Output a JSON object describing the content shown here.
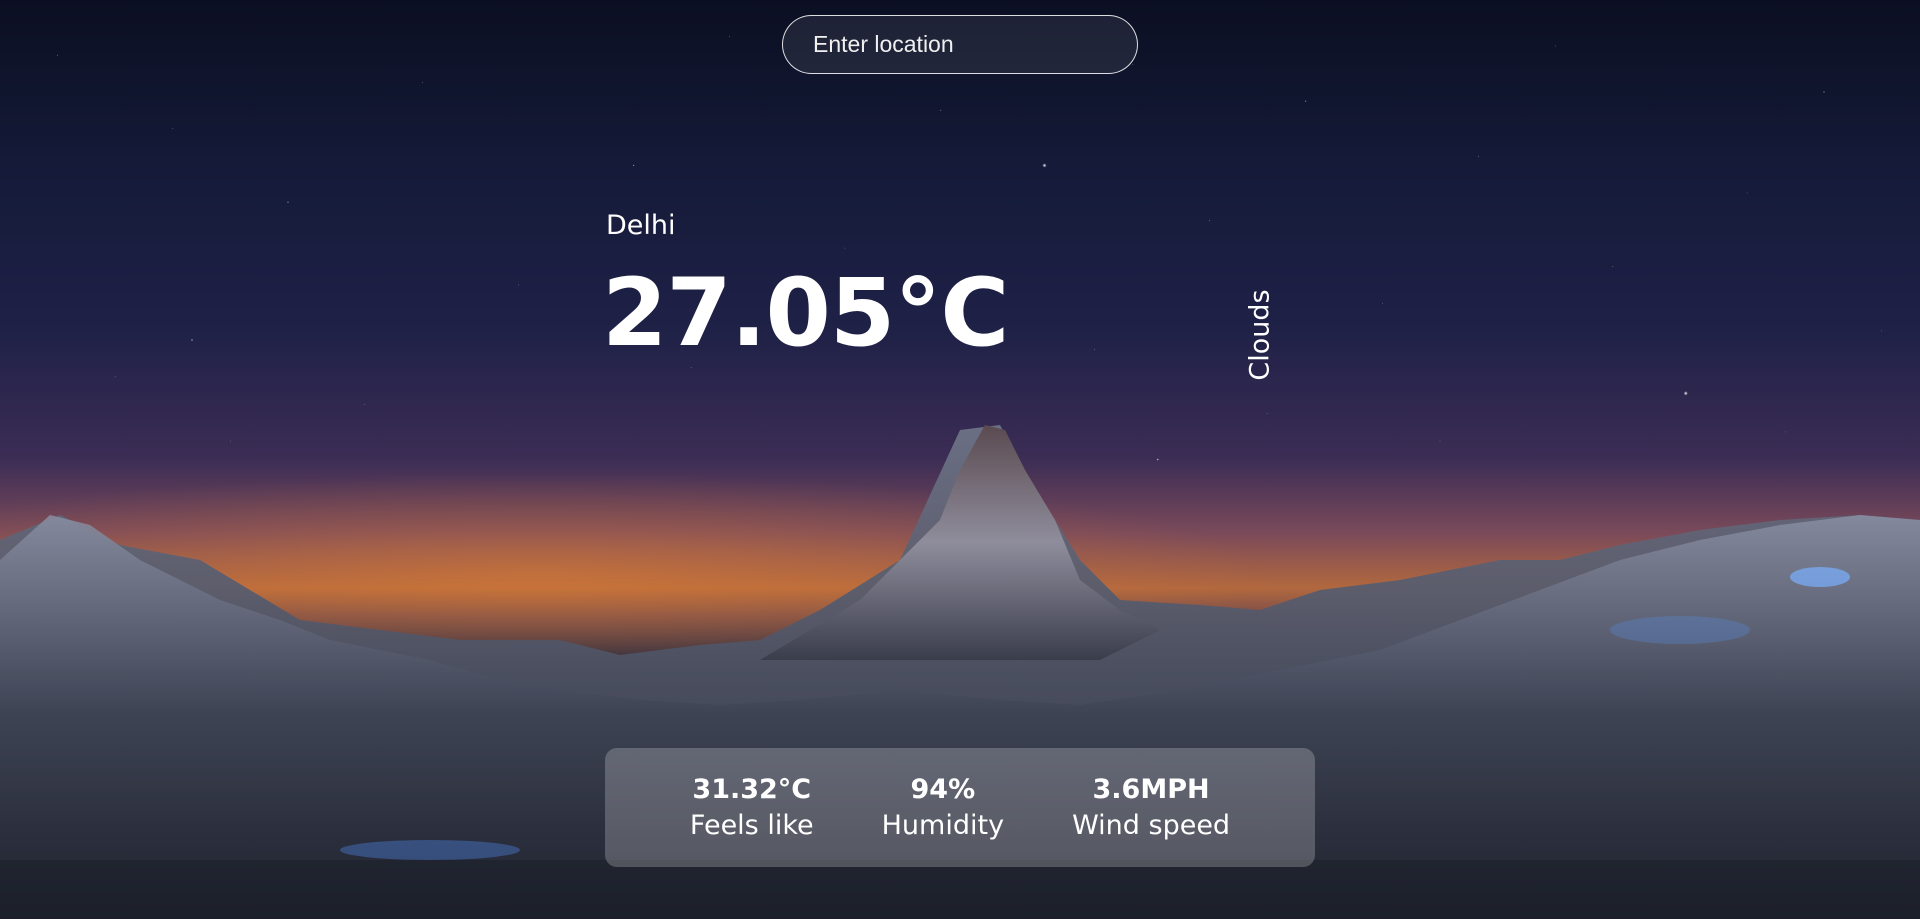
{
  "search": {
    "placeholder": "Enter location",
    "value": ""
  },
  "weather": {
    "location": "Delhi",
    "temperature": "27.05°C",
    "condition": "Clouds"
  },
  "stats": [
    {
      "value": "31.32°C",
      "label": "Feels like"
    },
    {
      "value": "94%",
      "label": "Humidity"
    },
    {
      "value": "3.6MPH",
      "label": "Wind speed"
    }
  ]
}
